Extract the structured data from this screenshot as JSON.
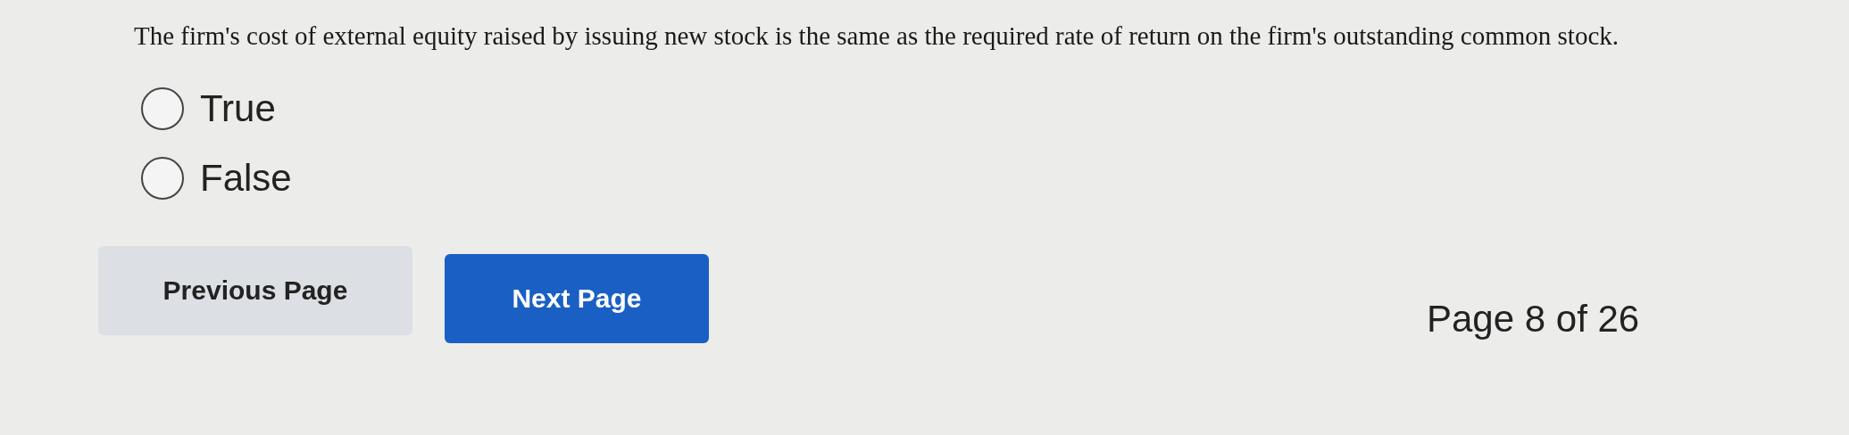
{
  "question": {
    "text": "The firm's cost of external equity raised by issuing new stock is the same as the required rate of return on the firm's outstanding common stock."
  },
  "options": [
    {
      "label": "True",
      "selected": false
    },
    {
      "label": "False",
      "selected": false
    }
  ],
  "buttons": [
    {
      "label": "Previous Page",
      "kind": "secondary"
    },
    {
      "label": "Next Page",
      "kind": "primary"
    }
  ],
  "page_indicator": "Page 8 of 26"
}
